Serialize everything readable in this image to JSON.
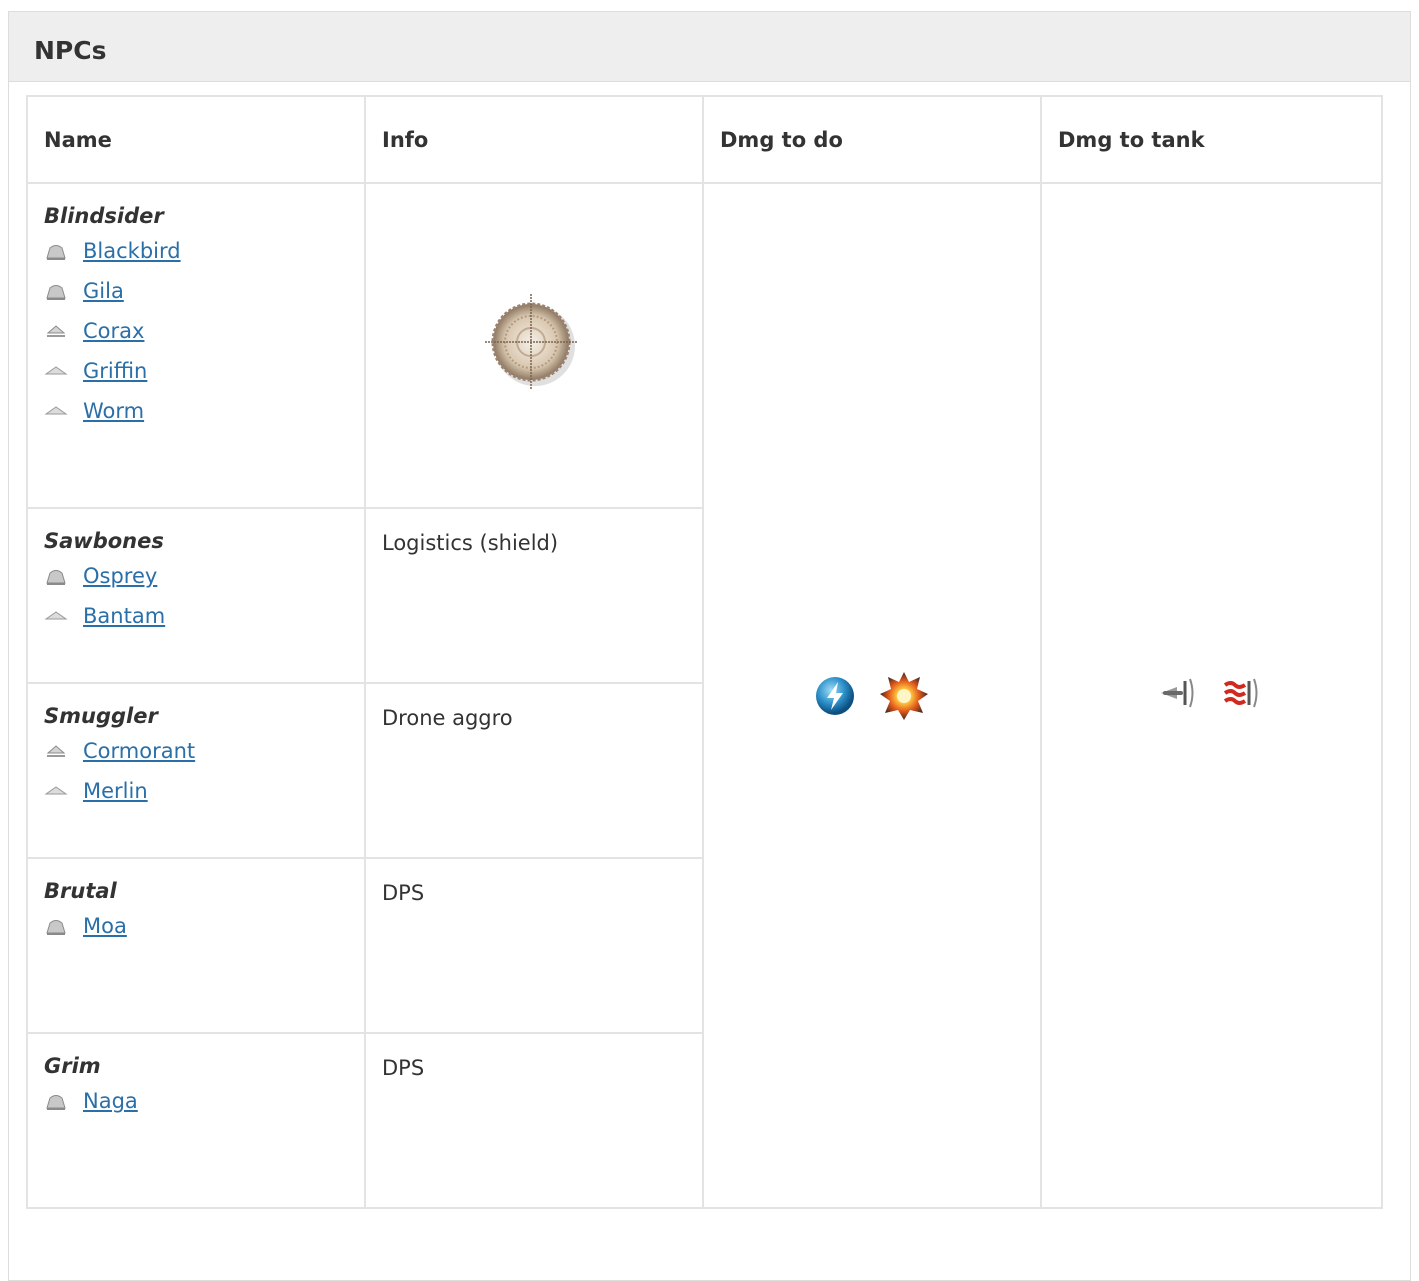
{
  "panel": {
    "title": "NPCs"
  },
  "table": {
    "headers": {
      "name": "Name",
      "info": "Info",
      "dmg_to_do": "Dmg to do",
      "dmg_to_tank": "Dmg to tank"
    },
    "groups": [
      {
        "name": "Blindsider",
        "info": "",
        "info_icon": "target-reticle-icon",
        "ships": [
          {
            "name": "Blackbird",
            "icon": "ship-hull-icon"
          },
          {
            "name": "Gila",
            "icon": "ship-hull-icon"
          },
          {
            "name": "Corax",
            "icon": "ship-hull-light-icon"
          },
          {
            "name": "Griffin",
            "icon": "ship-hull-small-icon"
          },
          {
            "name": "Worm",
            "icon": "ship-hull-small-icon"
          }
        ]
      },
      {
        "name": "Sawbones",
        "info": "Logistics (shield)",
        "ships": [
          {
            "name": "Osprey",
            "icon": "ship-hull-icon"
          },
          {
            "name": "Bantam",
            "icon": "ship-hull-small-icon"
          }
        ]
      },
      {
        "name": "Smuggler",
        "info": "Drone aggro",
        "ships": [
          {
            "name": "Cormorant",
            "icon": "ship-hull-light-icon"
          },
          {
            "name": "Merlin",
            "icon": "ship-hull-small-icon"
          }
        ]
      },
      {
        "name": "Brutal",
        "info": "DPS",
        "ships": [
          {
            "name": "Moa",
            "icon": "ship-hull-icon"
          }
        ]
      },
      {
        "name": "Grim",
        "info": "DPS",
        "ships": [
          {
            "name": "Naga",
            "icon": "ship-hull-icon"
          }
        ]
      }
    ],
    "dmg_to_do_icons": [
      "em-damage-icon",
      "explosive-damage-icon"
    ],
    "dmg_to_tank_icons": [
      "kinetic-damage-icon",
      "thermal-damage-icon"
    ]
  },
  "colors": {
    "link": "#2a6fa8",
    "header_bg": "#eeeeee",
    "border": "#e3e3e3"
  }
}
